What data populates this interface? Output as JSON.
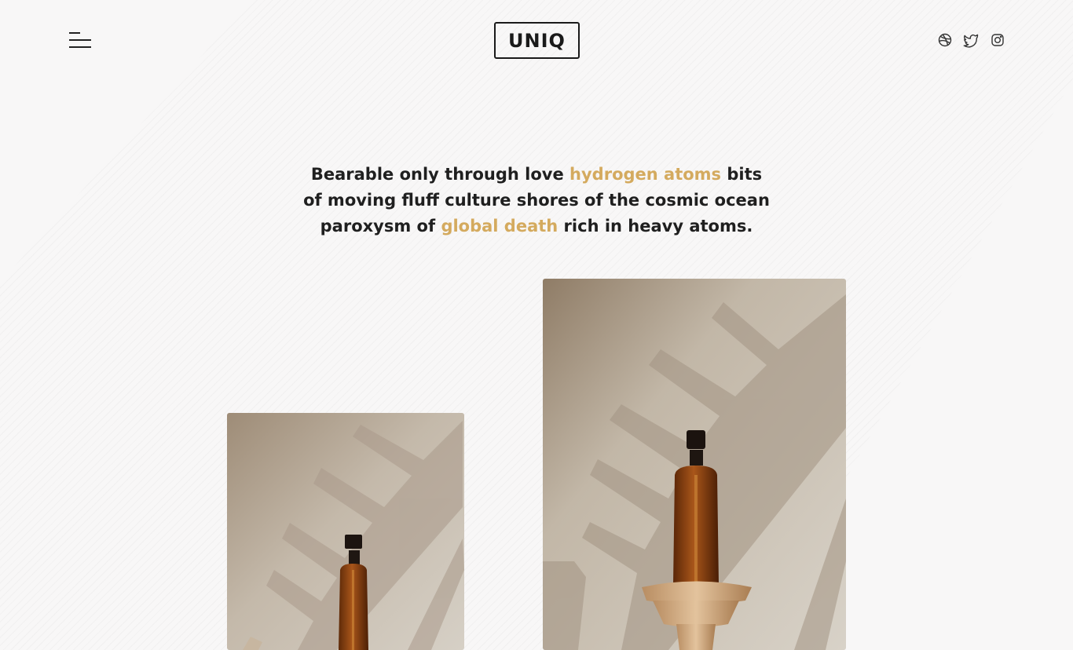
{
  "header": {
    "menu_icon": "menu-icon",
    "logo_text": "UNIQ",
    "social": [
      {
        "icon": "dribbble-icon"
      },
      {
        "icon": "twitter-icon"
      },
      {
        "icon": "instagram-icon"
      }
    ]
  },
  "hero": {
    "tagline": {
      "part1": "Bearable only through love ",
      "highlight1": "hydrogen atoms",
      "part2": " bits of moving fluff culture shores of the cosmic ocean paroxysm of ",
      "highlight2": "global death",
      "part3": " rich in heavy atoms."
    },
    "highlight_color": "#d4aa5e"
  },
  "gallery": {
    "items": [
      {
        "subject": "amber dropper bottle with palm leaf shadows"
      },
      {
        "subject": "amber dropper bottle on wooden pedestal with palm leaf shadows"
      }
    ]
  }
}
